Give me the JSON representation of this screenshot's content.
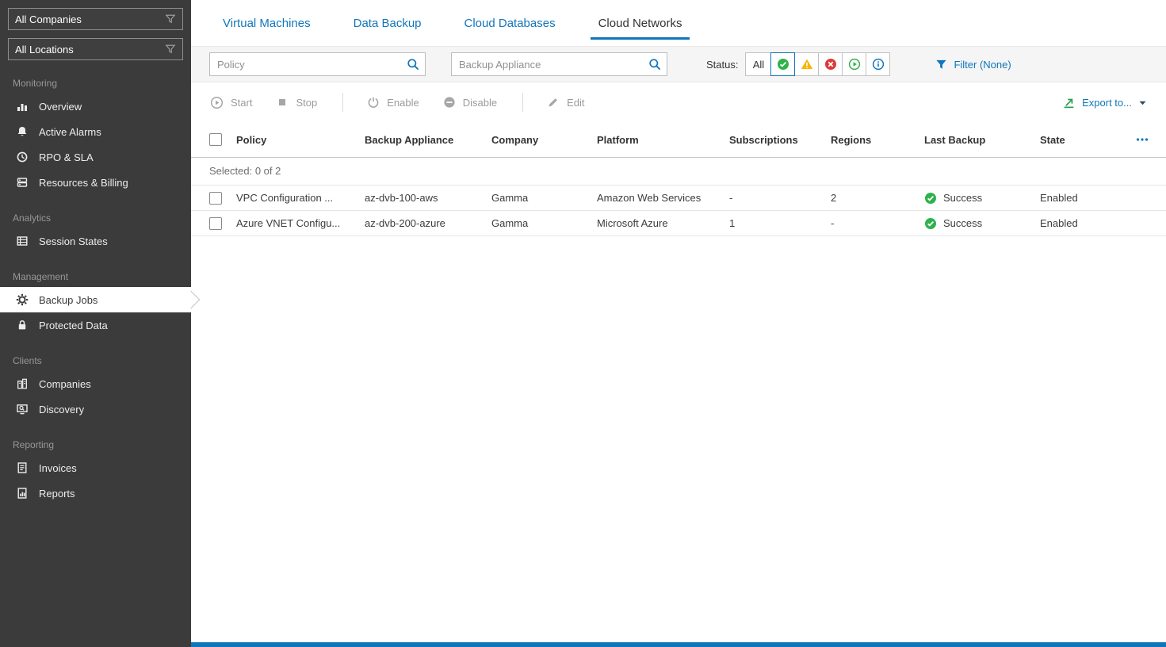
{
  "sidebar": {
    "filters": [
      {
        "label": "All Companies",
        "icon": "funnel"
      },
      {
        "label": "All Locations",
        "icon": "funnel"
      }
    ],
    "sections": [
      {
        "label": "Monitoring",
        "items": [
          {
            "label": "Overview",
            "icon": "dashboard-bars"
          },
          {
            "label": "Active Alarms",
            "icon": "bell"
          },
          {
            "label": "RPO & SLA",
            "icon": "clock"
          },
          {
            "label": "Resources & Billing",
            "icon": "server-stack"
          }
        ]
      },
      {
        "label": "Analytics",
        "items": [
          {
            "label": "Session States",
            "icon": "grid-table"
          }
        ]
      },
      {
        "label": "Management",
        "items": [
          {
            "label": "Backup Jobs",
            "icon": "gear",
            "active": true
          },
          {
            "label": "Protected Data",
            "icon": "lock"
          }
        ]
      },
      {
        "label": "Clients",
        "items": [
          {
            "label": "Companies",
            "icon": "buildings"
          },
          {
            "label": "Discovery",
            "icon": "monitor-magnifier"
          }
        ]
      },
      {
        "label": "Reporting",
        "items": [
          {
            "label": "Invoices",
            "icon": "document-lines"
          },
          {
            "label": "Reports",
            "icon": "document-chart"
          }
        ]
      }
    ]
  },
  "tabs": [
    {
      "label": "Virtual Machines",
      "active": false
    },
    {
      "label": "Data Backup",
      "active": false
    },
    {
      "label": "Cloud Databases",
      "active": false
    },
    {
      "label": "Cloud Networks",
      "active": true
    }
  ],
  "filter_bar": {
    "policy_placeholder": "Policy",
    "appliance_placeholder": "Backup Appliance",
    "status_label": "Status:",
    "status_filters": {
      "all_label": "All",
      "options": [
        "success",
        "warning",
        "error",
        "running",
        "info"
      ],
      "selected": "success"
    },
    "filter_link": "Filter (None)"
  },
  "toolbar": {
    "start_label": "Start",
    "stop_label": "Stop",
    "enable_label": "Enable",
    "disable_label": "Disable",
    "edit_label": "Edit",
    "export_label": "Export to..."
  },
  "table": {
    "selected_summary": "Selected: 0 of 2",
    "columns": {
      "policy": "Policy",
      "appliance": "Backup Appliance",
      "company": "Company",
      "platform": "Platform",
      "subscriptions": "Subscriptions",
      "regions": "Regions",
      "last_backup": "Last Backup",
      "state": "State"
    },
    "rows": [
      {
        "policy": "VPC Configuration ...",
        "appliance": "az-dvb-100-aws",
        "company": "Gamma",
        "platform": "Amazon Web Services",
        "subscriptions": "-",
        "regions": "2",
        "last_backup": "Success",
        "state": "Enabled"
      },
      {
        "policy": "Azure VNET Configu...",
        "appliance": "az-dvb-200-azure",
        "company": "Gamma",
        "platform": "Microsoft Azure",
        "subscriptions": "1",
        "regions": "-",
        "last_backup": "Success",
        "state": "Enabled"
      }
    ]
  },
  "colors": {
    "accent_blue": "#1076bc",
    "success_green": "#2fb24c",
    "warning_yellow": "#f7b500",
    "error_red": "#dd3b38",
    "export_green": "#2e9e4e",
    "sidebar_bg": "#3b3b3b",
    "filter_band_bg": "#f5f5f5"
  }
}
